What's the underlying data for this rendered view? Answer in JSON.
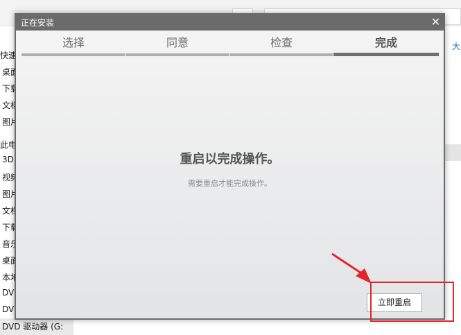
{
  "background_window": {
    "right_pane": {
      "column_label": "大"
    },
    "sidebar": [
      "快速访",
      "桌面",
      "下载",
      "文档",
      "图片",
      "此电脑",
      "3D",
      "视频",
      "图片",
      "文档",
      "下载",
      "音乐",
      "桌面",
      "本地",
      "DVD",
      "DVD"
    ],
    "bottom_item": "DVD 驱动器 (G:"
  },
  "dialog": {
    "title": "正在安装",
    "close_icon": "close-icon",
    "steps": [
      {
        "label": "选择",
        "current": false
      },
      {
        "label": "同意",
        "current": false
      },
      {
        "label": "检查",
        "current": false
      },
      {
        "label": "完成",
        "current": true
      }
    ],
    "message": "重启以完成操作。",
    "submessage": "需要重启才能完成操作。",
    "restart_button": "立即重启"
  },
  "annotation": {
    "color": "#e0262b"
  }
}
